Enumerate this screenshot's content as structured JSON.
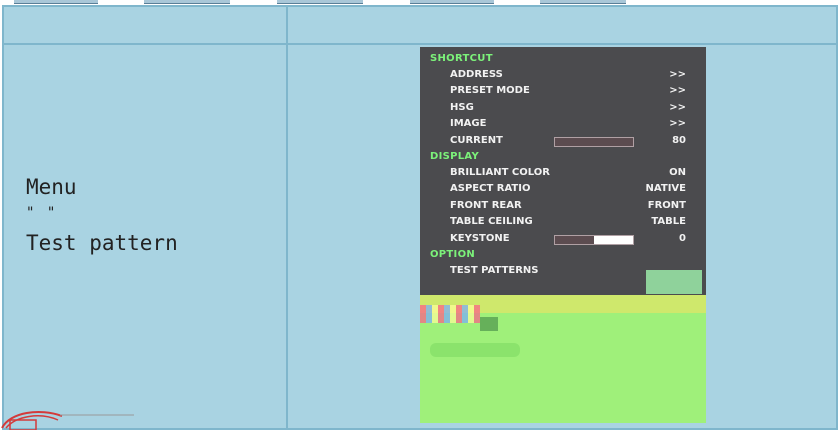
{
  "description": {
    "line1": "Menu",
    "line2": "\"    \"",
    "line3": "Test pattern"
  },
  "osd": {
    "sections": [
      {
        "header": "SHORTCUT",
        "items": [
          {
            "label": "ADDRESS",
            "value": ">>"
          },
          {
            "label": "PRESET MODE",
            "value": ">>"
          },
          {
            "label": "HSG",
            "value": ">>"
          },
          {
            "label": "IMAGE",
            "value": ">>"
          },
          {
            "label": "CURRENT",
            "value": "80",
            "slider_level": 0.0
          }
        ]
      },
      {
        "header": "DISPLAY",
        "items": [
          {
            "label": "BRILLIANT COLOR",
            "value": "ON"
          },
          {
            "label": "ASPECT RATIO",
            "value": "NATIVE"
          },
          {
            "label": "FRONT REAR",
            "value": "FRONT"
          },
          {
            "label": "TABLE CEILING",
            "value": "TABLE"
          },
          {
            "label": "KEYSTONE",
            "value": "0",
            "slider_level": 0.5
          }
        ]
      },
      {
        "header": "OPTION",
        "items": [
          {
            "label": "TEST PATTERNS",
            "value": ""
          }
        ]
      }
    ]
  },
  "colors": {
    "table_cell": "#a9d3e2",
    "table_border": "#7fb6cc",
    "osd_background": "#4b4b4e",
    "osd_header": "#7cf27a",
    "osd_text": "#f2f2f2"
  }
}
